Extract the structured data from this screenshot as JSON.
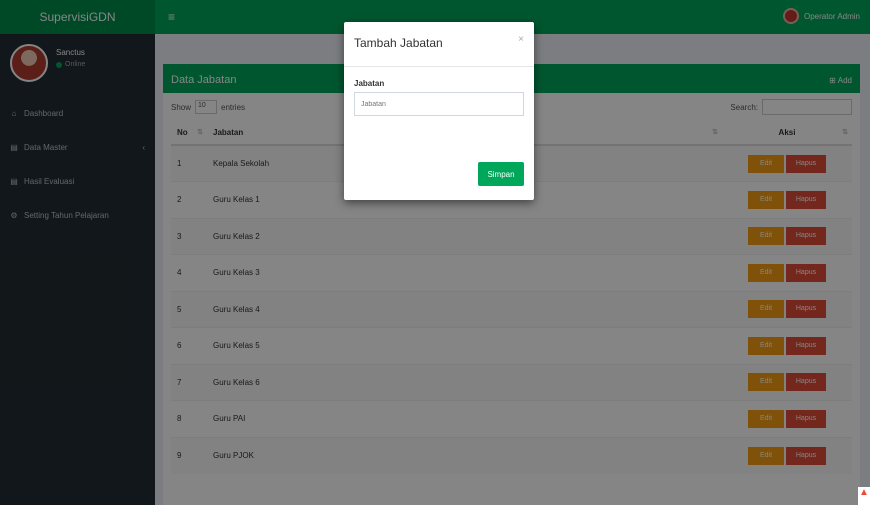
{
  "app": {
    "title": "SupervisiGDN"
  },
  "topbar": {
    "menu_icon": "≡",
    "user_name": "Operator Admin"
  },
  "sidebar": {
    "user": {
      "name": "Sanctus",
      "status": "Online"
    },
    "items": [
      {
        "label": "Dashboard",
        "icon": "home-icon",
        "glyph": "⌂"
      },
      {
        "label": "Data Master",
        "icon": "database-icon",
        "glyph": "▤",
        "chevron": "‹"
      },
      {
        "label": "Hasil Evaluasi",
        "icon": "document-icon",
        "glyph": "▤"
      },
      {
        "label": "Setting Tahun Pelajaran",
        "icon": "gear-icon",
        "glyph": "⚙"
      }
    ]
  },
  "box": {
    "title": "Data Jabatan",
    "add_label": "Add",
    "show_label": "Show",
    "entries_value": "10",
    "entries_suffix": "entries",
    "search_label": "Search:"
  },
  "table": {
    "headers": [
      "No",
      "Jabatan",
      "Aksi"
    ],
    "rows": [
      {
        "no": "1",
        "jabatan": "Kepala Sekolah"
      },
      {
        "no": "2",
        "jabatan": "Guru Kelas 1"
      },
      {
        "no": "3",
        "jabatan": "Guru Kelas 2"
      },
      {
        "no": "4",
        "jabatan": "Guru Kelas 3"
      },
      {
        "no": "5",
        "jabatan": "Guru Kelas 4"
      },
      {
        "no": "6",
        "jabatan": "Guru Kelas 5"
      },
      {
        "no": "7",
        "jabatan": "Guru Kelas 6"
      },
      {
        "no": "8",
        "jabatan": "Guru PAI"
      },
      {
        "no": "9",
        "jabatan": "Guru PJOK"
      }
    ],
    "edit_label": "Edit",
    "hapus_label": "Hapus"
  },
  "modal": {
    "title": "Tambah Jabatan",
    "close": "×",
    "field_label": "Jabatan",
    "field_placeholder": "Jabatan",
    "submit_label": "Simpan"
  },
  "colors": {
    "primary": "#00a65a",
    "warning": "#f39c12",
    "danger": "#dd4b39",
    "sidebar": "#222d32"
  }
}
